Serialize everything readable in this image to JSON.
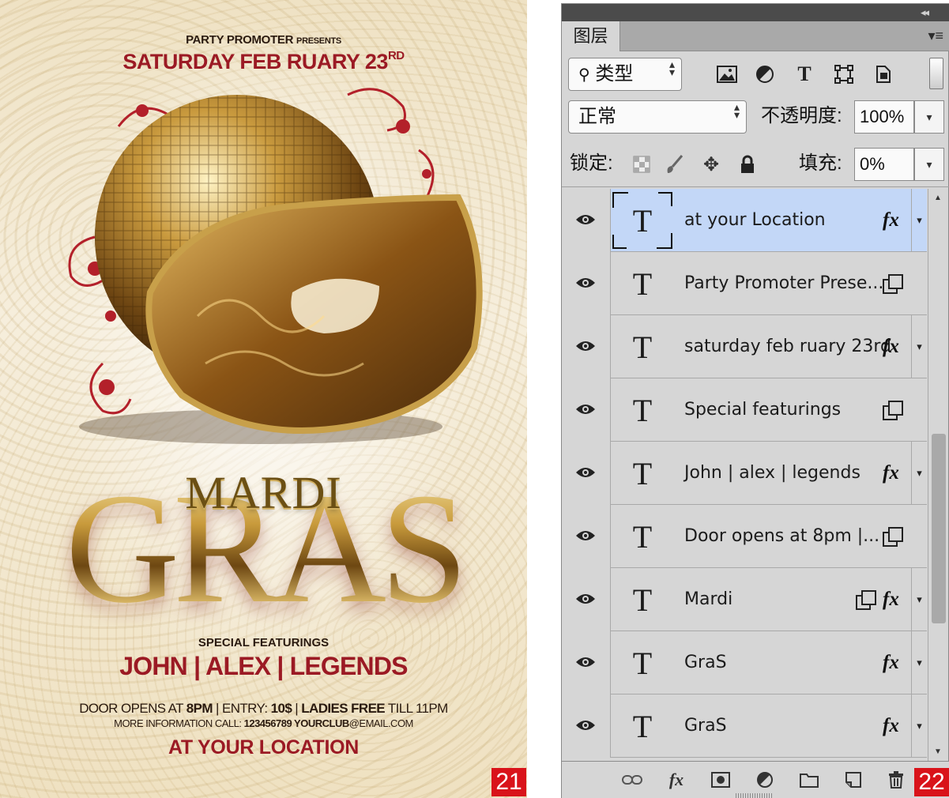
{
  "poster": {
    "presenter_main": "PARTY PROMOTER",
    "presenter_small": "PRESENTS",
    "date_text": "SATURDAY FEB RUARY 23",
    "date_sup": "RD",
    "title_top": "MARDI",
    "title_main": "GRAS",
    "special_label": "SPECIAL FEATURINGS",
    "headliners": "JOHN | ALEX | LEGENDS",
    "door_prefix": "DOOR OPENS AT ",
    "door_time": "8PM",
    "door_mid1": " | ENTRY: ",
    "door_entry": "10$",
    "door_mid2": " | ",
    "door_ladies": "LADIES FREE",
    "door_suffix": " TILL 11PM",
    "more_prefix": "MORE INFORMATION CALL: ",
    "more_phone": "123456789 YOURCLUB",
    "more_suffix": "@EMAIL.COM",
    "location": "AT YOUR LOCATION",
    "badge": "21"
  },
  "panel": {
    "collapse_glyph": "◂◂",
    "tab_label": "图层",
    "menu_glyph": "▾≡",
    "filter_type_label": "类型",
    "blend_mode": "正常",
    "opacity_label": "不透明度:",
    "opacity_value": "100%",
    "lock_label": "锁定:",
    "fill_label": "填充:",
    "fill_value": "0%",
    "badge": "22",
    "layers": [
      {
        "name": "at your Location",
        "selected": true,
        "fx": true,
        "linked": false
      },
      {
        "name": "Party Promoter Prese...",
        "selected": false,
        "fx": false,
        "linked": true
      },
      {
        "name": "saturday feb ruary 23rd",
        "selected": false,
        "fx": true,
        "linked": false
      },
      {
        "name": "Special featurings",
        "selected": false,
        "fx": false,
        "linked": true
      },
      {
        "name": "John | alex | legends",
        "selected": false,
        "fx": true,
        "linked": false
      },
      {
        "name": "Door opens at 8pm |...",
        "selected": false,
        "fx": false,
        "linked": true
      },
      {
        "name": "Mardi",
        "selected": false,
        "fx": true,
        "linked": true
      },
      {
        "name": "GraS",
        "selected": false,
        "fx": true,
        "linked": false
      },
      {
        "name": "GraS",
        "selected": false,
        "fx": true,
        "linked": false
      }
    ],
    "thumb_glyph": "T",
    "fx_glyph": "fx"
  },
  "colors": {
    "accent_red": "#9b1a24",
    "selection_blue": "#c3d7f7",
    "panel_gray": "#d6d6d6",
    "badge_red": "#d9131a"
  }
}
